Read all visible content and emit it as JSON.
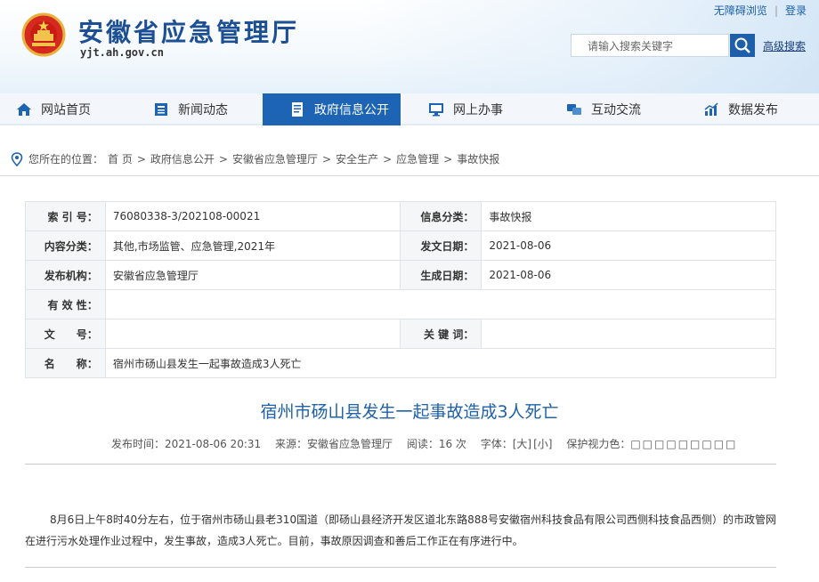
{
  "header": {
    "site_title": "安徽省应急管理厅",
    "domain": "yjt.ah.gov.cn",
    "top_links": [
      "无障碍浏览",
      "登录"
    ],
    "search_placeholder": "请输入搜索关键字",
    "advanced_search": "高级搜索"
  },
  "nav": {
    "items": [
      {
        "label": "网站首页",
        "icon": "home-icon"
      },
      {
        "label": "新闻动态",
        "icon": "news-icon"
      },
      {
        "label": "政府信息公开",
        "icon": "document-icon",
        "active": true
      },
      {
        "label": "网上办事",
        "icon": "monitor-icon"
      },
      {
        "label": "互动交流",
        "icon": "chat-icon"
      },
      {
        "label": "数据发布",
        "icon": "chart-icon"
      }
    ]
  },
  "breadcrumb": {
    "prefix": "您所在的位置：",
    "items": [
      "首 页",
      "政府信息公开",
      "安徽省应急管理厅",
      "安全生产",
      "应急管理",
      "事故快报"
    ],
    "separator": ">"
  },
  "meta": {
    "index_label": "索 引 号：",
    "index_value": "76080338-3/202108-00021",
    "category_label": "信息分类：",
    "category_value": "事故快报",
    "content_label": "内容分类：",
    "content_value": "其他,市场监管、应急管理,2021年",
    "date_label": "发文日期：",
    "date_value": "2021-08-06",
    "org_label": "发布机构：",
    "org_value": "安徽省应急管理厅",
    "gen_label": "生成日期：",
    "gen_value": "2021-08-06",
    "valid_label": "有 效 性：",
    "valid_value": "",
    "docno_label": "文　　号：",
    "docno_value": "",
    "keywords_label": "关 键 词：",
    "keywords_value": "",
    "name_label": "名　　称：",
    "name_value": "宿州市砀山县发生一起事故造成3人死亡"
  },
  "article": {
    "title": "宿州市砀山县发生一起事故造成3人死亡",
    "publish_time": "发布时间：2021-08-06 20:31",
    "source": "来源：安徽省应急管理厅",
    "reads": "阅读：16 次",
    "font_label": "字体：",
    "font_large": "[大]",
    "font_small": "[小]",
    "eye_label": "保护视力色：",
    "eye_colors": "□□□□□□□□□",
    "body": "8月6日上午8时40分左右，位于宿州市砀山县老310国道（即砀山县经济开发区道北东路888号安徽宿州科技食品有限公司西侧科技食品西侧）的市政管网在进行污水处理作业过程中，发生事故，造成3人死亡。目前，事故原因调查和善后工作正在有序进行中。"
  },
  "colors": {
    "brand_blue": "#1c4f93",
    "nav_active": "#1d64b4",
    "title_blue": "#2061a8"
  }
}
